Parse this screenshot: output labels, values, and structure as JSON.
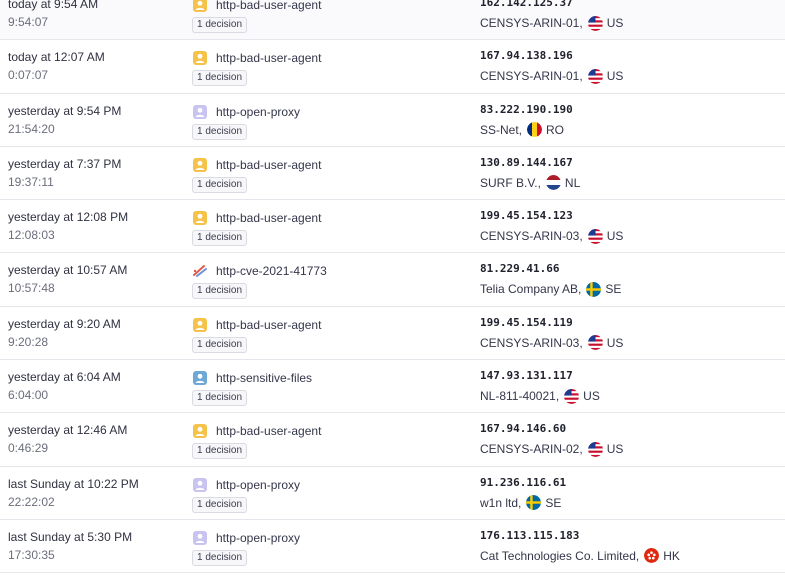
{
  "colors": {
    "bad_user_agent": "#f5c24a",
    "open_proxy": "#c9c3ef",
    "sensitive_files": "#6fa8d6",
    "cve": "#e25a4a"
  },
  "rows": [
    {
      "time_rel": "today at 9:54 AM",
      "time_abs": "9:54:07",
      "scenario": "http-bad-user-agent",
      "scenario_icon": "bad-user-agent-icon",
      "decisions": "1 decision",
      "ip": "162.142.125.37",
      "network": "CENSYS-ARIN-01,",
      "country": "US",
      "flag": "flag-us-icon"
    },
    {
      "time_rel": "today at 12:07 AM",
      "time_abs": "0:07:07",
      "scenario": "http-bad-user-agent",
      "scenario_icon": "bad-user-agent-icon",
      "decisions": "1 decision",
      "ip": "167.94.138.196",
      "network": "CENSYS-ARIN-01,",
      "country": "US",
      "flag": "flag-us-icon"
    },
    {
      "time_rel": "yesterday at 9:54 PM",
      "time_abs": "21:54:20",
      "scenario": "http-open-proxy",
      "scenario_icon": "open-proxy-icon",
      "decisions": "1 decision",
      "ip": "83.222.190.190",
      "network": "SS-Net,",
      "country": "RO",
      "flag": "flag-ro-icon"
    },
    {
      "time_rel": "yesterday at 7:37 PM",
      "time_abs": "19:37:11",
      "scenario": "http-bad-user-agent",
      "scenario_icon": "bad-user-agent-icon",
      "decisions": "1 decision",
      "ip": "130.89.144.167",
      "network": "SURF B.V.,",
      "country": "NL",
      "flag": "flag-nl-icon"
    },
    {
      "time_rel": "yesterday at 12:08 PM",
      "time_abs": "12:08:03",
      "scenario": "http-bad-user-agent",
      "scenario_icon": "bad-user-agent-icon",
      "decisions": "1 decision",
      "ip": "199.45.154.123",
      "network": "CENSYS-ARIN-03,",
      "country": "US",
      "flag": "flag-us-icon"
    },
    {
      "time_rel": "yesterday at 10:57 AM",
      "time_abs": "10:57:48",
      "scenario": "http-cve-2021-41773",
      "scenario_icon": "cve-icon",
      "decisions": "1 decision",
      "ip": "81.229.41.66",
      "network": "Telia Company AB,",
      "country": "SE",
      "flag": "flag-se-icon"
    },
    {
      "time_rel": "yesterday at 9:20 AM",
      "time_abs": "9:20:28",
      "scenario": "http-bad-user-agent",
      "scenario_icon": "bad-user-agent-icon",
      "decisions": "1 decision",
      "ip": "199.45.154.119",
      "network": "CENSYS-ARIN-03,",
      "country": "US",
      "flag": "flag-us-icon"
    },
    {
      "time_rel": "yesterday at 6:04 AM",
      "time_abs": "6:04:00",
      "scenario": "http-sensitive-files",
      "scenario_icon": "sensitive-files-icon",
      "decisions": "1 decision",
      "ip": "147.93.131.117",
      "network": "NL-811-40021,",
      "country": "US",
      "flag": "flag-us-icon"
    },
    {
      "time_rel": "yesterday at 12:46 AM",
      "time_abs": "0:46:29",
      "scenario": "http-bad-user-agent",
      "scenario_icon": "bad-user-agent-icon",
      "decisions": "1 decision",
      "ip": "167.94.146.60",
      "network": "CENSYS-ARIN-02,",
      "country": "US",
      "flag": "flag-us-icon"
    },
    {
      "time_rel": "last Sunday at 10:22 PM",
      "time_abs": "22:22:02",
      "scenario": "http-open-proxy",
      "scenario_icon": "open-proxy-icon",
      "decisions": "1 decision",
      "ip": "91.236.116.61",
      "network": "w1n ltd,",
      "country": "SE",
      "flag": "flag-se-icon"
    },
    {
      "time_rel": "last Sunday at 5:30 PM",
      "time_abs": "17:30:35",
      "scenario": "http-open-proxy",
      "scenario_icon": "open-proxy-icon",
      "decisions": "1 decision",
      "ip": "176.113.115.183",
      "network": "Cat Technologies Co. Limited,",
      "country": "HK",
      "flag": "flag-hk-icon"
    }
  ]
}
